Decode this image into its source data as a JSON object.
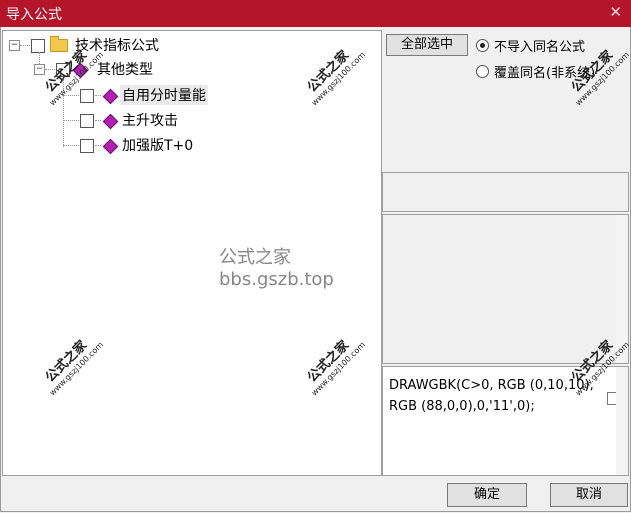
{
  "window": {
    "title": "导入公式",
    "close_glyph": "✕"
  },
  "tree": {
    "root": {
      "label": "技术指标公式",
      "expander": "−"
    },
    "group": {
      "label": "其他类型",
      "expander": "−"
    },
    "items": [
      {
        "label": "自用分时量能",
        "selected": true
      },
      {
        "label": "主升攻击",
        "selected": false
      },
      {
        "label": "加强版T+0",
        "selected": false
      }
    ]
  },
  "options": {
    "select_all_label": "全部选中",
    "radio_no_import": "不导入同名公式",
    "radio_overwrite": "覆盖同名(非系统)"
  },
  "code": {
    "text": "DRAWGBK(C>0, RGB (0,10,10),RGB (88,0,0),0,'11',0);"
  },
  "footer": {
    "ok_label": "确定",
    "cancel_label": "取消"
  },
  "watermark": {
    "center": "公式之家 bbs.gszb.top",
    "stamp_cn": "公式之家",
    "stamp_url": "www.gszj100.com"
  }
}
